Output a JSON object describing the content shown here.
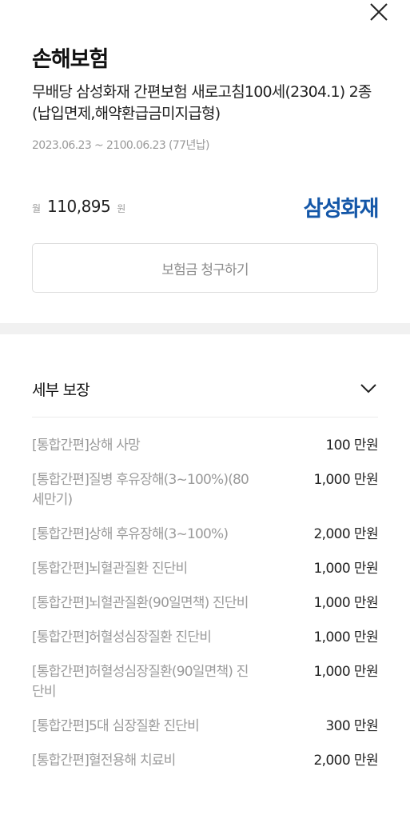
{
  "header": {
    "category": "손해보험",
    "product_name": "무배당 삼성화재 간편보험 새로고침100세(2304.1) 2종(납입면제,해약환급금미지급형)",
    "period": "2023.06.23 ~ 2100.06.23 (77년납)"
  },
  "price": {
    "prefix": "월",
    "amount": "110,895",
    "suffix": "원"
  },
  "insurer": {
    "name": "삼성화재",
    "color": "#1457a8"
  },
  "claim_button": {
    "label": "보험금 청구하기"
  },
  "coverage": {
    "title": "세부 보장",
    "items": [
      {
        "name": "[통합간편]상해 사망",
        "amount": "100 만원"
      },
      {
        "name": "[통합간편]질병 후유장해(3~100%)(80세만기)",
        "amount": "1,000 만원"
      },
      {
        "name": "[통합간편]상해 후유장해(3~100%)",
        "amount": "2,000 만원"
      },
      {
        "name": "[통합간편]뇌혈관질환 진단비",
        "amount": "1,000 만원"
      },
      {
        "name": "[통합간편]뇌혈관질환(90일면책) 진단비",
        "amount": "1,000 만원"
      },
      {
        "name": "[통합간편]허혈성심장질환 진단비",
        "amount": "1,000 만원"
      },
      {
        "name": "[통합간편]허혈성심장질환(90일면책) 진단비",
        "amount": "1,000 만원"
      },
      {
        "name": "[통합간편]5대 심장질환 진단비",
        "amount": "300 만원"
      },
      {
        "name": "[통합간편]혈전용해 치료비",
        "amount": "2,000 만원"
      }
    ]
  }
}
